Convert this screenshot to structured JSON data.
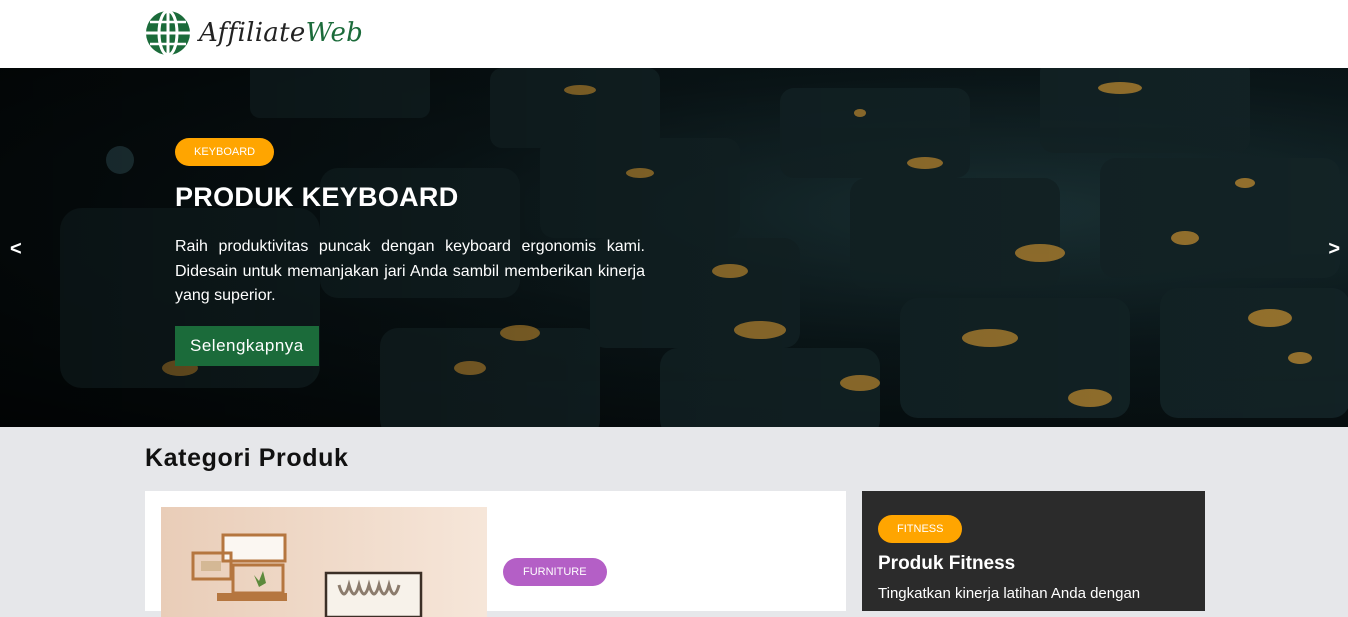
{
  "navbar": {
    "brand_main": "Affiliate",
    "brand_accent": "Web",
    "logo_icon": "globe-icon"
  },
  "hero": {
    "badge": "KEYBOARD",
    "title": "PRODUK KEYBOARD",
    "description": "Raih produktivitas puncak dengan keyboard ergonomis kami. Didesain untuk memanjakan jari Anda sambil memberikan kinerja yang superior.",
    "button_label": "Selengkapnya",
    "prev_label": "<",
    "next_label": ">"
  },
  "categories": {
    "title": "Kategori Produk",
    "main_card": {
      "badge": "FURNITURE",
      "badge_color": "#b45fc6"
    },
    "side_card": {
      "badge": "FITNESS",
      "title": "Produk Fitness",
      "text": "Tingkatkan kinerja latihan Anda dengan"
    }
  },
  "colors": {
    "brand_green": "#1b6b3a",
    "badge_orange": "#ffa500",
    "dark_card": "#2b2b2b"
  }
}
